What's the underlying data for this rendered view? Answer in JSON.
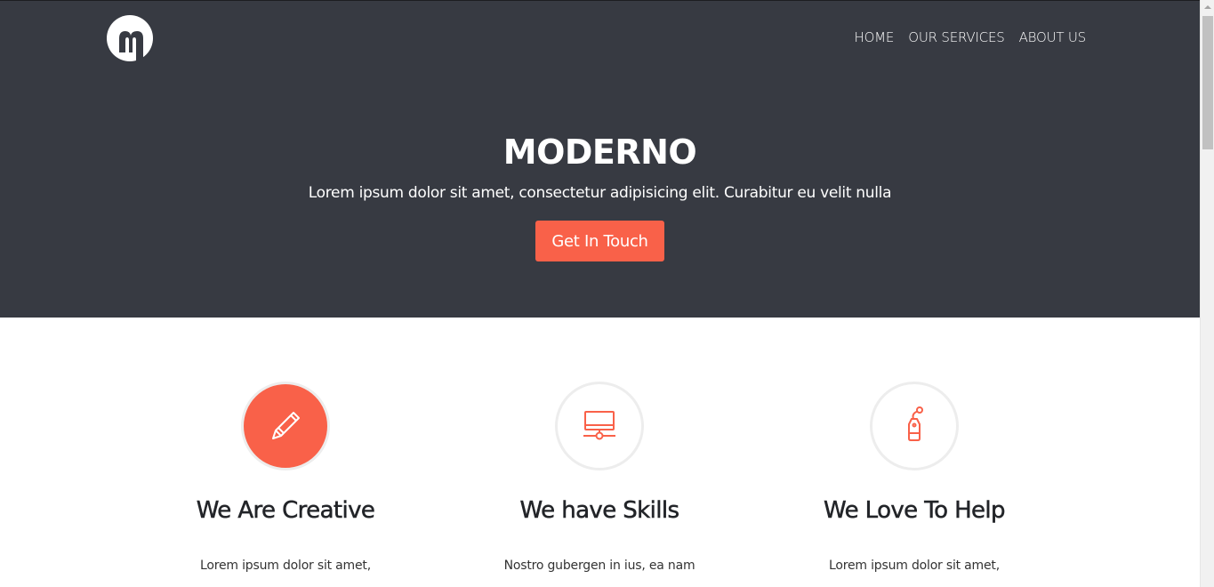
{
  "brand": {
    "logo_icon": "moderno-m-logo",
    "accent_color": "#f96149",
    "hero_bg": "#373a42"
  },
  "nav": {
    "items": [
      {
        "label": "HOME"
      },
      {
        "label": "OUR SERVICES"
      },
      {
        "label": "ABOUT US"
      }
    ]
  },
  "hero": {
    "title": "MODERNO",
    "subtitle": "Lorem ipsum dolor sit amet, consectetur adipisicing elit. Curabitur eu velit nulla",
    "cta_label": "Get In Touch"
  },
  "features": [
    {
      "icon": "pencil-icon",
      "title": "We Are Creative",
      "text": "Lorem ipsum dolor sit amet,"
    },
    {
      "icon": "monitor-network-icon",
      "title": "We have Skills",
      "text": "Nostro gubergen in ius, ea nam"
    },
    {
      "icon": "tag-icon",
      "title": "We Love To Help",
      "text": "Lorem ipsum dolor sit amet,"
    }
  ]
}
